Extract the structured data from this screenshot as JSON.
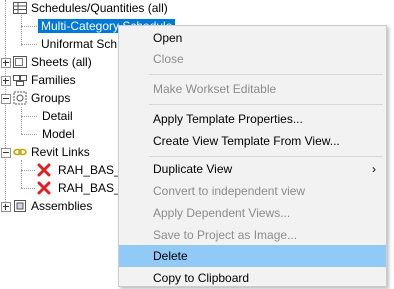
{
  "tree": {
    "schedules": "Schedules/Quantities (all)",
    "multi_category": "Multi-Category Schedule",
    "uniformat": "Uniformat Sch",
    "sheets": "Sheets (all)",
    "families": "Families",
    "groups": "Groups",
    "detail": "Detail",
    "model": "Model",
    "revit_links": "Revit Links",
    "link1": "RAH_BAS_A",
    "link2": "RAH_BAS_S",
    "assemblies": "Assemblies"
  },
  "menu": {
    "open": "Open",
    "close": "Close",
    "make_workset_editable": "Make Workset Editable",
    "apply_template": "Apply Template Properties...",
    "create_template": "Create View Template From View...",
    "duplicate_view": "Duplicate View",
    "submenu_arrow": "›",
    "convert": "Convert to independent view",
    "apply_dependent": "Apply Dependent Views...",
    "save_to_project": "Save to Project as Image...",
    "delete": "Delete",
    "copy_clipboard": "Copy to Clipboard"
  },
  "colors": {
    "selection": "#0078d7",
    "menu_highlight": "#91c9f7",
    "menu_bg": "#f2f2f2",
    "disabled_text": "#8c8c8c",
    "error_red": "#e02020"
  }
}
